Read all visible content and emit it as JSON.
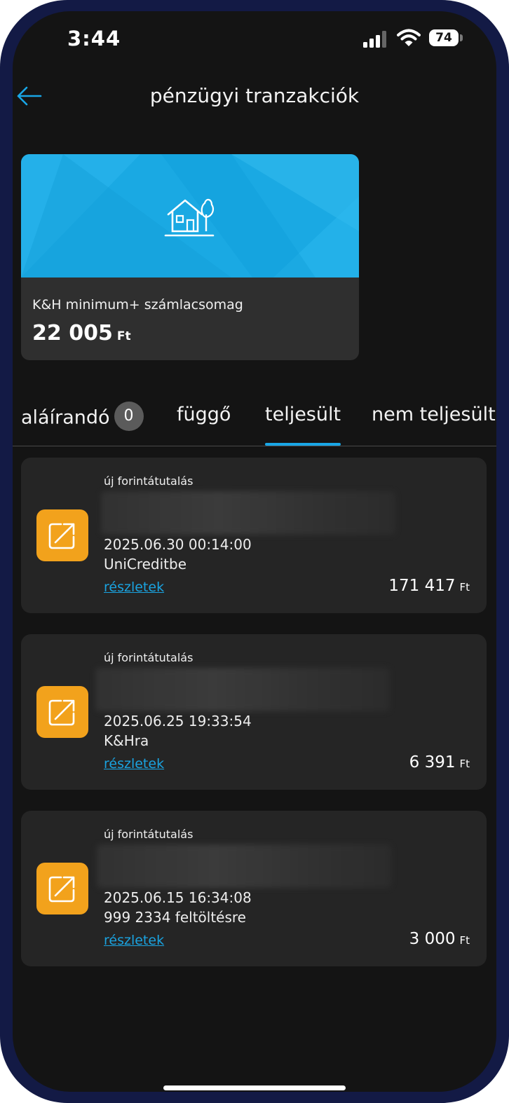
{
  "status_bar": {
    "time": "3:44",
    "battery": "74"
  },
  "nav": {
    "title": "pénzügyi tranzakciók",
    "accent_color": "#19a6e6"
  },
  "account_card": {
    "name": "K&H minimum+ számlacsomag",
    "balance": "22 005",
    "currency": "Ft",
    "banner_color": "#1aa9e3"
  },
  "tabs": [
    {
      "label": "aláírandó",
      "count": "0",
      "active": false
    },
    {
      "label": "függő",
      "active": false
    },
    {
      "label": "teljesült",
      "active": true
    },
    {
      "label": "nem teljesült",
      "active": false
    }
  ],
  "transactions": [
    {
      "type": "új forintátutalás",
      "date": "2025.06.30 00:14:00",
      "description": "UniCreditbe",
      "link": "részletek",
      "amount": "171 417",
      "currency": "Ft"
    },
    {
      "type": "új forintátutalás",
      "date": "2025.06.25 19:33:54",
      "description": "K&Hra",
      "link": "részletek",
      "amount": "6 391",
      "currency": "Ft"
    },
    {
      "type": "új forintátutalás",
      "date": "2025.06.15 16:34:08",
      "description": "999 2334 feltöltésre",
      "link": "részletek",
      "amount": "3 000",
      "currency": "Ft"
    }
  ],
  "icons": {
    "back": "arrow-left-icon",
    "card": "house-tree-icon",
    "transaction": "external-arrow-icon"
  }
}
